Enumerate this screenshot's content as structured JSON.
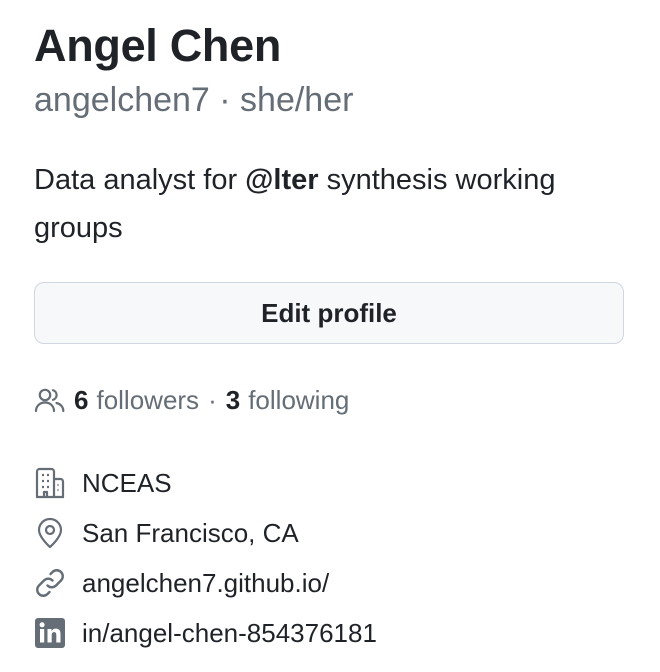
{
  "profile": {
    "display_name": "Angel Chen",
    "username": "angelchen7",
    "pronouns_separator": " · ",
    "pronouns": "she/her",
    "bio_prefix": "Data analyst for ",
    "bio_mention": "@lter",
    "bio_suffix": " synthesis working groups"
  },
  "actions": {
    "edit_profile_label": "Edit profile"
  },
  "social": {
    "followers_count": "6",
    "followers_label": "followers",
    "separator": "·",
    "following_count": "3",
    "following_label": "following",
    "icon": "people-icon"
  },
  "details": {
    "organization": {
      "icon": "organization-icon",
      "text": "NCEAS"
    },
    "location": {
      "icon": "location-icon",
      "text": "San Francisco, CA"
    },
    "website": {
      "icon": "link-icon",
      "text": "angelchen7.github.io/"
    },
    "linkedin": {
      "icon": "linkedin-icon",
      "text": "in/angel-chen-854376181"
    }
  },
  "colors": {
    "text_primary": "#1f2328",
    "text_muted": "#656d76",
    "button_bg": "#f6f8fa",
    "button_border": "#d0d7de"
  }
}
